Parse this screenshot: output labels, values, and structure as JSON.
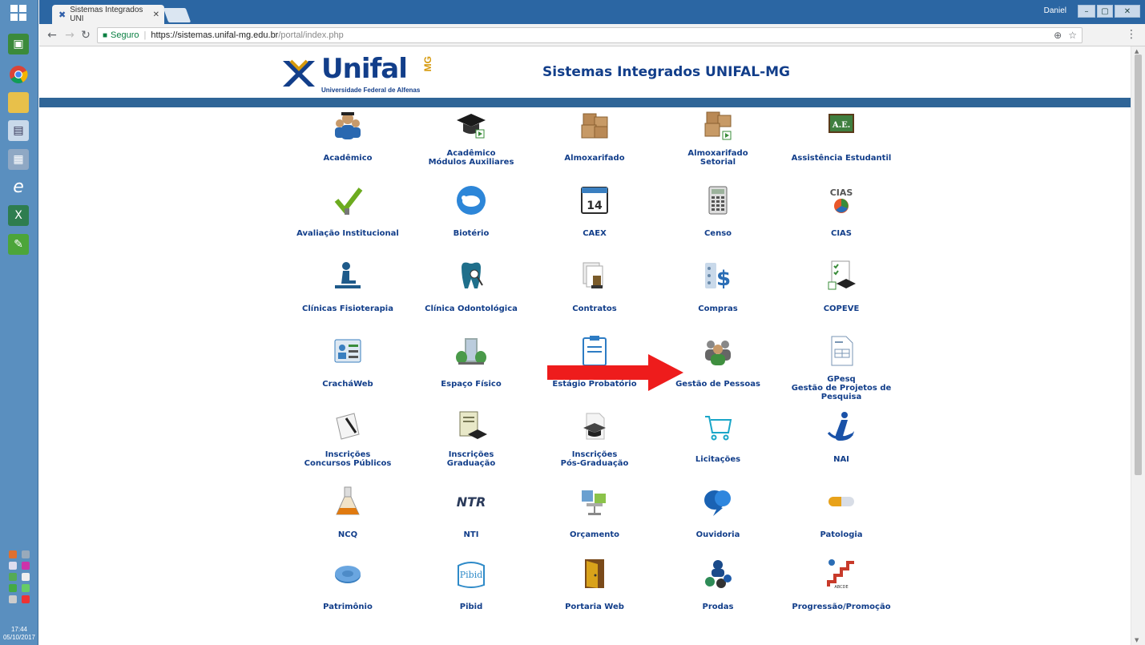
{
  "browser": {
    "tab_title": "Sistemas Integrados UNI",
    "profile_name": "Daniel",
    "secure_label": "Seguro",
    "url_host": "https://sistemas.unifal-mg.edu.br",
    "url_path": "/portal/index.php"
  },
  "taskbar": {
    "time": "17:44",
    "date": "05/10/2017"
  },
  "header": {
    "logo_text": "Unifal",
    "logo_subtitle": "Universidade Federal de Alfenas",
    "logo_badge": "MG",
    "title": "Sistemas Integrados UNIFAL-MG"
  },
  "systems": [
    {
      "label": "Acadêmico",
      "icon": "graduates-icon",
      "accent": "#2a68b0"
    },
    {
      "label": "Acadêmico\nMódulos Auxiliares",
      "icon": "mortarboard-icon",
      "accent": "#1a1a1a"
    },
    {
      "label": "Almoxarifado",
      "icon": "boxes-icon",
      "accent": "#b98955"
    },
    {
      "label": "Almoxarifado\nSetorial",
      "icon": "boxes-sector-icon",
      "accent": "#b98955"
    },
    {
      "label": "Assistência Estudantil",
      "icon": "ae-board-icon",
      "accent": "#3f7f3f"
    },
    {
      "label": "Avaliação Institucional",
      "icon": "checkmark-icon",
      "accent": "#6cab1f"
    },
    {
      "label": "Biotério",
      "icon": "rat-icon",
      "accent": "#2d86d8"
    },
    {
      "label": "CAEX",
      "icon": "calendar-icon",
      "accent": "#2b2b2b"
    },
    {
      "label": "Censo",
      "icon": "calculator-icon",
      "accent": "#666666"
    },
    {
      "label": "CIAS",
      "icon": "cias-logo-icon",
      "accent": "#555555"
    },
    {
      "label": "Clínicas Fisioterapia",
      "icon": "physio-icon",
      "accent": "#1e5a8a"
    },
    {
      "label": "Clínica Odontológica",
      "icon": "tooth-icon",
      "accent": "#1f6f8b"
    },
    {
      "label": "Contratos",
      "icon": "contract-stamp-icon",
      "accent": "#7a5b2a"
    },
    {
      "label": "Compras",
      "icon": "dollar-list-icon",
      "accent": "#2a6db5"
    },
    {
      "label": "COPEVE",
      "icon": "exam-icon",
      "accent": "#3a8c3a"
    },
    {
      "label": "CracháWeb",
      "icon": "badge-icon",
      "accent": "#3a7fbf"
    },
    {
      "label": "Espaço Físico",
      "icon": "building-icon",
      "accent": "#4a9a4a"
    },
    {
      "label": "Estágio Probatório",
      "icon": "clipboard-icon",
      "accent": "#2d7cc4"
    },
    {
      "label": "Gestão de Pessoas",
      "icon": "people-icon",
      "accent": "#3f8f3f"
    },
    {
      "label": "GPesq\nGestão de Projetos de\nPesquisa",
      "icon": "document-table-icon",
      "accent": "#7a96b4"
    },
    {
      "label": "Inscrições\nConcursos Públicos",
      "icon": "pen-paper-icon",
      "accent": "#999999"
    },
    {
      "label": "Inscrições\nGraduação",
      "icon": "certificate-cap-icon",
      "accent": "#777755"
    },
    {
      "label": "Inscrições\nPós-Graduação",
      "icon": "page-cap-icon",
      "accent": "#444444"
    },
    {
      "label": "Licitações",
      "icon": "cart-icon",
      "accent": "#1aa6c8"
    },
    {
      "label": "NAI",
      "icon": "nai-logo-icon",
      "accent": "#1a52a8"
    },
    {
      "label": "NCQ",
      "icon": "flask-icon",
      "accent": "#e07a10"
    },
    {
      "label": "NTI",
      "icon": "nti-logo-icon",
      "accent": "#2a3a5a"
    },
    {
      "label": "Orçamento",
      "icon": "budget-icon",
      "accent": "#4a7aa5"
    },
    {
      "label": "Ouvidoria",
      "icon": "speech-bubbles-icon",
      "accent": "#1a62b3"
    },
    {
      "label": "Patologia",
      "icon": "capsule-icon",
      "accent": "#e8a21a"
    },
    {
      "label": "Patrimônio",
      "icon": "coin-icon",
      "accent": "#3a7fc0"
    },
    {
      "label": "Pibid",
      "icon": "pibid-logo-icon",
      "accent": "#2e8ac8"
    },
    {
      "label": "Portaria Web",
      "icon": "door-icon",
      "accent": "#d9a21a"
    },
    {
      "label": "Prodas",
      "icon": "person-chips-icon",
      "accent": "#1a4a8a"
    },
    {
      "label": "Progressão/Promoção",
      "icon": "stairs-icon",
      "accent": "#c83a2a"
    }
  ]
}
